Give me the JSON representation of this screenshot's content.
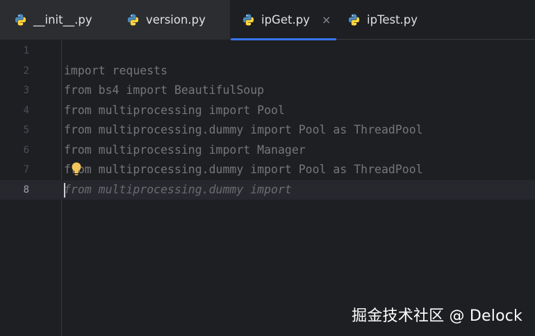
{
  "tabs": [
    {
      "label": "__init__.py",
      "icon": "python-file-icon"
    },
    {
      "label": "version.py",
      "icon": "python-file-icon"
    },
    {
      "label": "ipGet.py",
      "icon": "python-file-icon",
      "active": true,
      "close": "×"
    },
    {
      "label": "ipTest.py",
      "icon": "python-file-icon"
    }
  ],
  "editor": {
    "lines": [
      {
        "number": "1",
        "text": ""
      },
      {
        "number": "2",
        "text": "import requests"
      },
      {
        "number": "3",
        "text": "from bs4 import BeautifulSoup"
      },
      {
        "number": "4",
        "text": "from multiprocessing import Pool"
      },
      {
        "number": "5",
        "text": "from multiprocessing.dummy import Pool as ThreadPool"
      },
      {
        "number": "6",
        "text": "from multiprocessing import Manager"
      },
      {
        "number": "7",
        "text": "from multiprocessing.dummy import Pool as ThreadPool"
      },
      {
        "number": "8",
        "text": "from multiprocessing.dummy import",
        "current": true
      }
    ],
    "intention_icon": "lightbulb-icon"
  },
  "watermark": "掘金技术社区 @ Delock",
  "colors": {
    "background": "#1e1f22",
    "active_tab_underline": "#3574f0",
    "current_line": "#26282e",
    "text": "#bcbec4"
  }
}
